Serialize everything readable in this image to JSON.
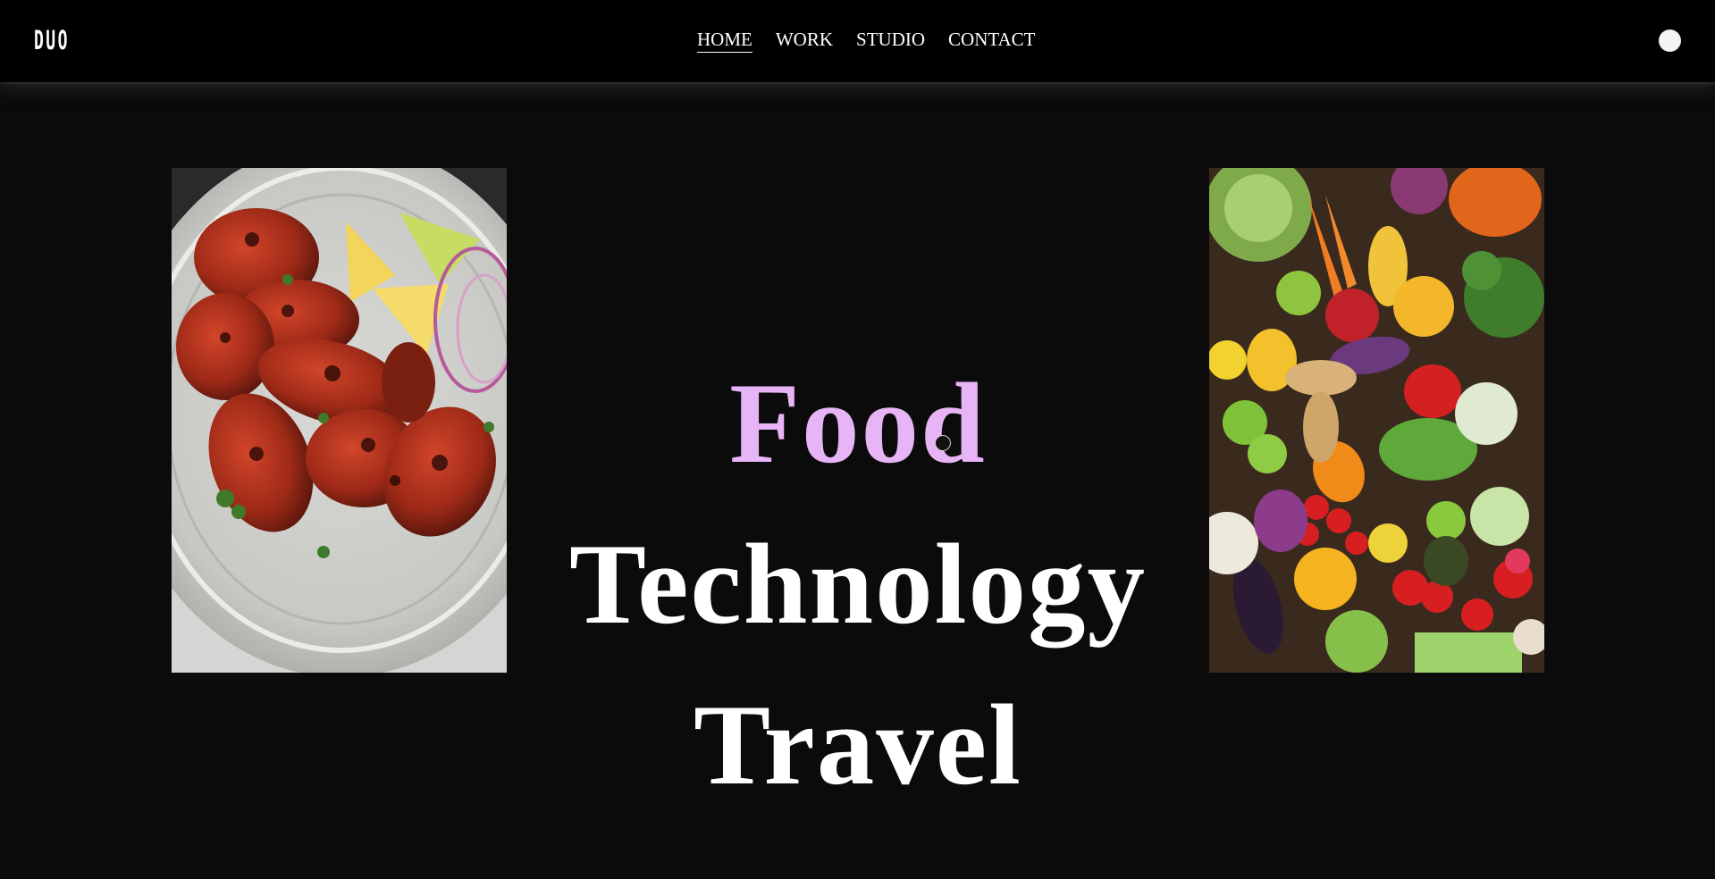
{
  "brand": {
    "logo_text": "DUO"
  },
  "nav": {
    "items": [
      {
        "label": "HOME",
        "active": true
      },
      {
        "label": "WORK",
        "active": false
      },
      {
        "label": "STUDIO",
        "active": false
      },
      {
        "label": "CONTACT",
        "active": false
      }
    ]
  },
  "theme_toggle": {
    "icon": "circle-toggle-icon"
  },
  "hero": {
    "words": [
      {
        "text": "Food",
        "color": "#e7b4f6"
      },
      {
        "text": "Technology",
        "color": "#ffffff"
      },
      {
        "text": "Travel",
        "color": "#ffffff"
      }
    ]
  },
  "images": {
    "left": {
      "subject": "tandoori-chicken-plate"
    },
    "right": {
      "subject": "fresh-vegetables-assortment"
    }
  },
  "colors": {
    "background": "#0c0b0c",
    "nav_background": "#000000",
    "accent": "#e7b4f6",
    "text": "#ffffff"
  }
}
